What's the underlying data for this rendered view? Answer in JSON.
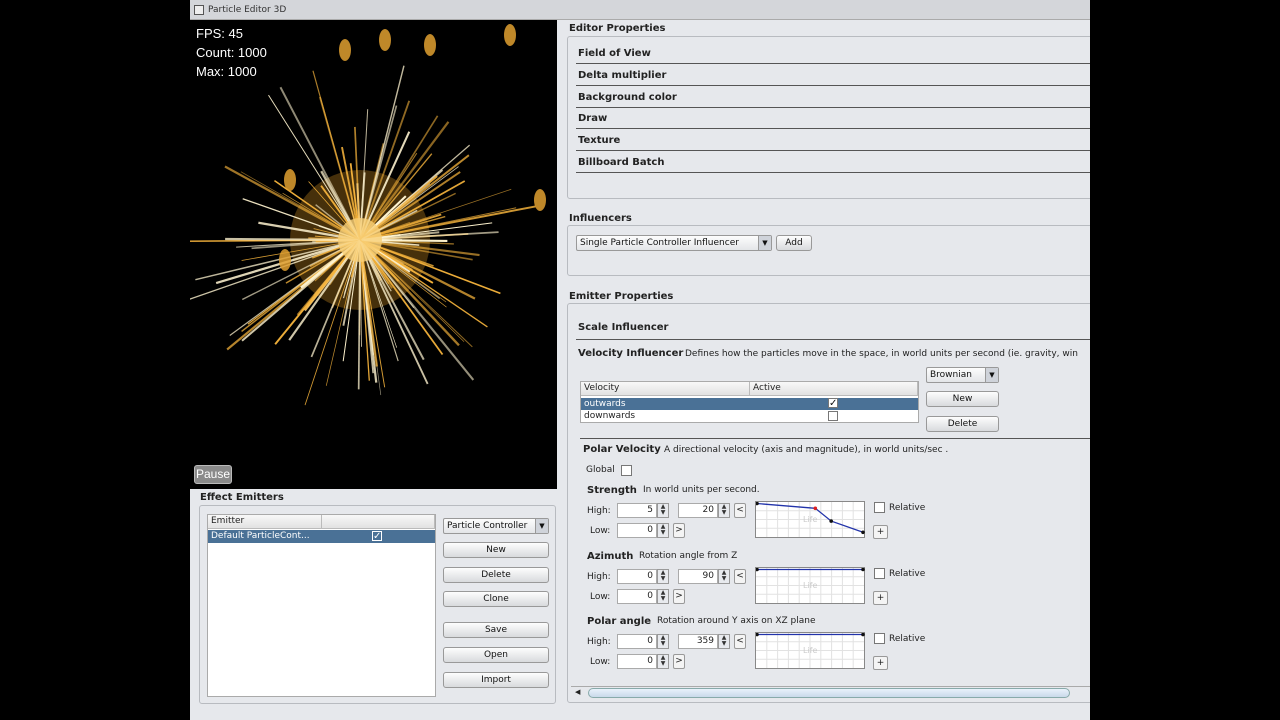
{
  "window": {
    "title": "Particle Editor 3D"
  },
  "viewport": {
    "fps": "FPS: 45",
    "count": "Count: 1000",
    "max": "Max: 1000",
    "pause": "Pause"
  },
  "effect_emitters": {
    "title": "Effect Emitters",
    "col1": "Emitter",
    "rows": [
      {
        "name": "Default ParticleCont...",
        "checked": true
      }
    ],
    "type": "Particle Controller",
    "buttons": [
      "New",
      "Delete",
      "Clone",
      "Save",
      "Open",
      "Import"
    ]
  },
  "editor_properties": {
    "title": "Editor Properties",
    "items": [
      "Field of View",
      "Delta multiplier",
      "Background color",
      "Draw",
      "Texture",
      "Billboard Batch"
    ]
  },
  "influencers": {
    "title": "Influencers",
    "selected": "Single Particle Controller Influencer",
    "add": "Add"
  },
  "emitter_properties": {
    "title": "Emitter Properties",
    "scale": "Scale Influencer",
    "velocity": {
      "title": "Velocity Influencer",
      "desc": "Defines how the particles move in the space, in world units per second (ie. gravity, win",
      "columns": [
        "Velocity",
        "Active"
      ],
      "rows": [
        {
          "name": "outwards",
          "active": true
        },
        {
          "name": "downwards",
          "active": false
        }
      ],
      "type": "Brownian",
      "new": "New",
      "delete": "Delete"
    },
    "polar": {
      "title": "Polar Velocity",
      "desc": "A directional velocity (axis and magnitude), in world units/sec .",
      "global": "Global",
      "groups": [
        {
          "title": "Strength",
          "desc": "In world units per second.",
          "high_a": "5",
          "high_b": "20",
          "low": "0",
          "curve": [
            [
              0,
              1
            ],
            [
              0.55,
              0.85
            ],
            [
              0.7,
              0.45
            ],
            [
              1,
              0.1
            ]
          ]
        },
        {
          "title": "Azimuth",
          "desc": "Rotation angle from Z",
          "high_a": "0",
          "high_b": "90",
          "low": "0",
          "curve": [
            [
              0,
              1
            ],
            [
              1,
              1
            ]
          ]
        },
        {
          "title": "Polar angle",
          "desc": "Rotation around Y axis on XZ plane",
          "high_a": "0",
          "high_b": "359",
          "low": "0",
          "curve": [
            [
              0,
              1
            ],
            [
              1,
              1
            ]
          ]
        }
      ],
      "high": "High:",
      "low_lbl": "Low:",
      "relative": "Relative",
      "life": "Life",
      "lt": "<",
      "gt": ">",
      "plus": "+"
    }
  },
  "colors": {
    "selection": "#4a7196",
    "particle": "#f5b33c"
  }
}
